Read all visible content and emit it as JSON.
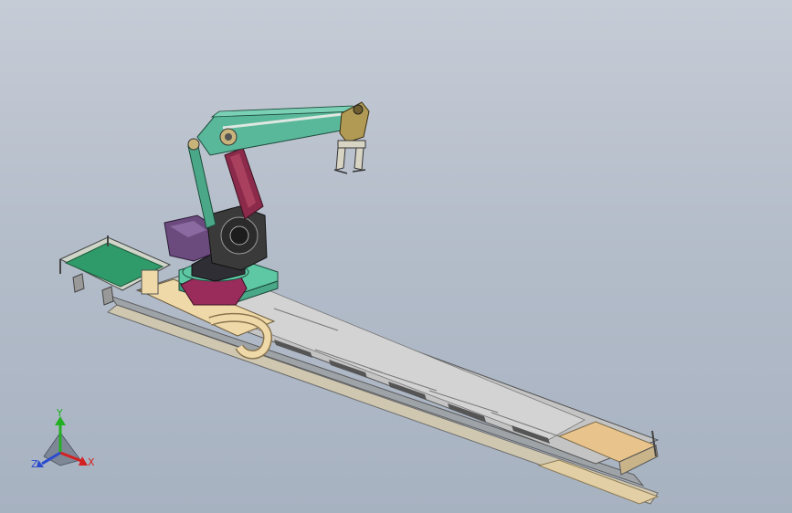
{
  "viewport": {
    "background_top": "#c6ccd6",
    "background_bottom": "#a7b2c1"
  },
  "model": {
    "parts": {
      "infeed_conveyor": "#2f9a6a",
      "rail_track": "#b9b9b9",
      "rail_top": "#d8d8d8",
      "end_pad": "#e8c48c",
      "cable_chain": "#efd9a8",
      "robot_base": "#5ec8a5",
      "robot_waist": "#9a2c5c",
      "lower_arm": "#8b2a4a",
      "shoulder_housing": "#3a3a3a",
      "motor_cover": "#6b4a7e",
      "upper_arm": "#5ab89a",
      "parallel_link": "#4aa888",
      "wrist": "#b09a54",
      "gripper": "#d8d4c4"
    }
  },
  "triad": {
    "x_label": "X",
    "y_label": "Y",
    "z_label": "Z",
    "x_color": "#d42020",
    "y_color": "#22b022",
    "z_color": "#2a4ad0"
  }
}
